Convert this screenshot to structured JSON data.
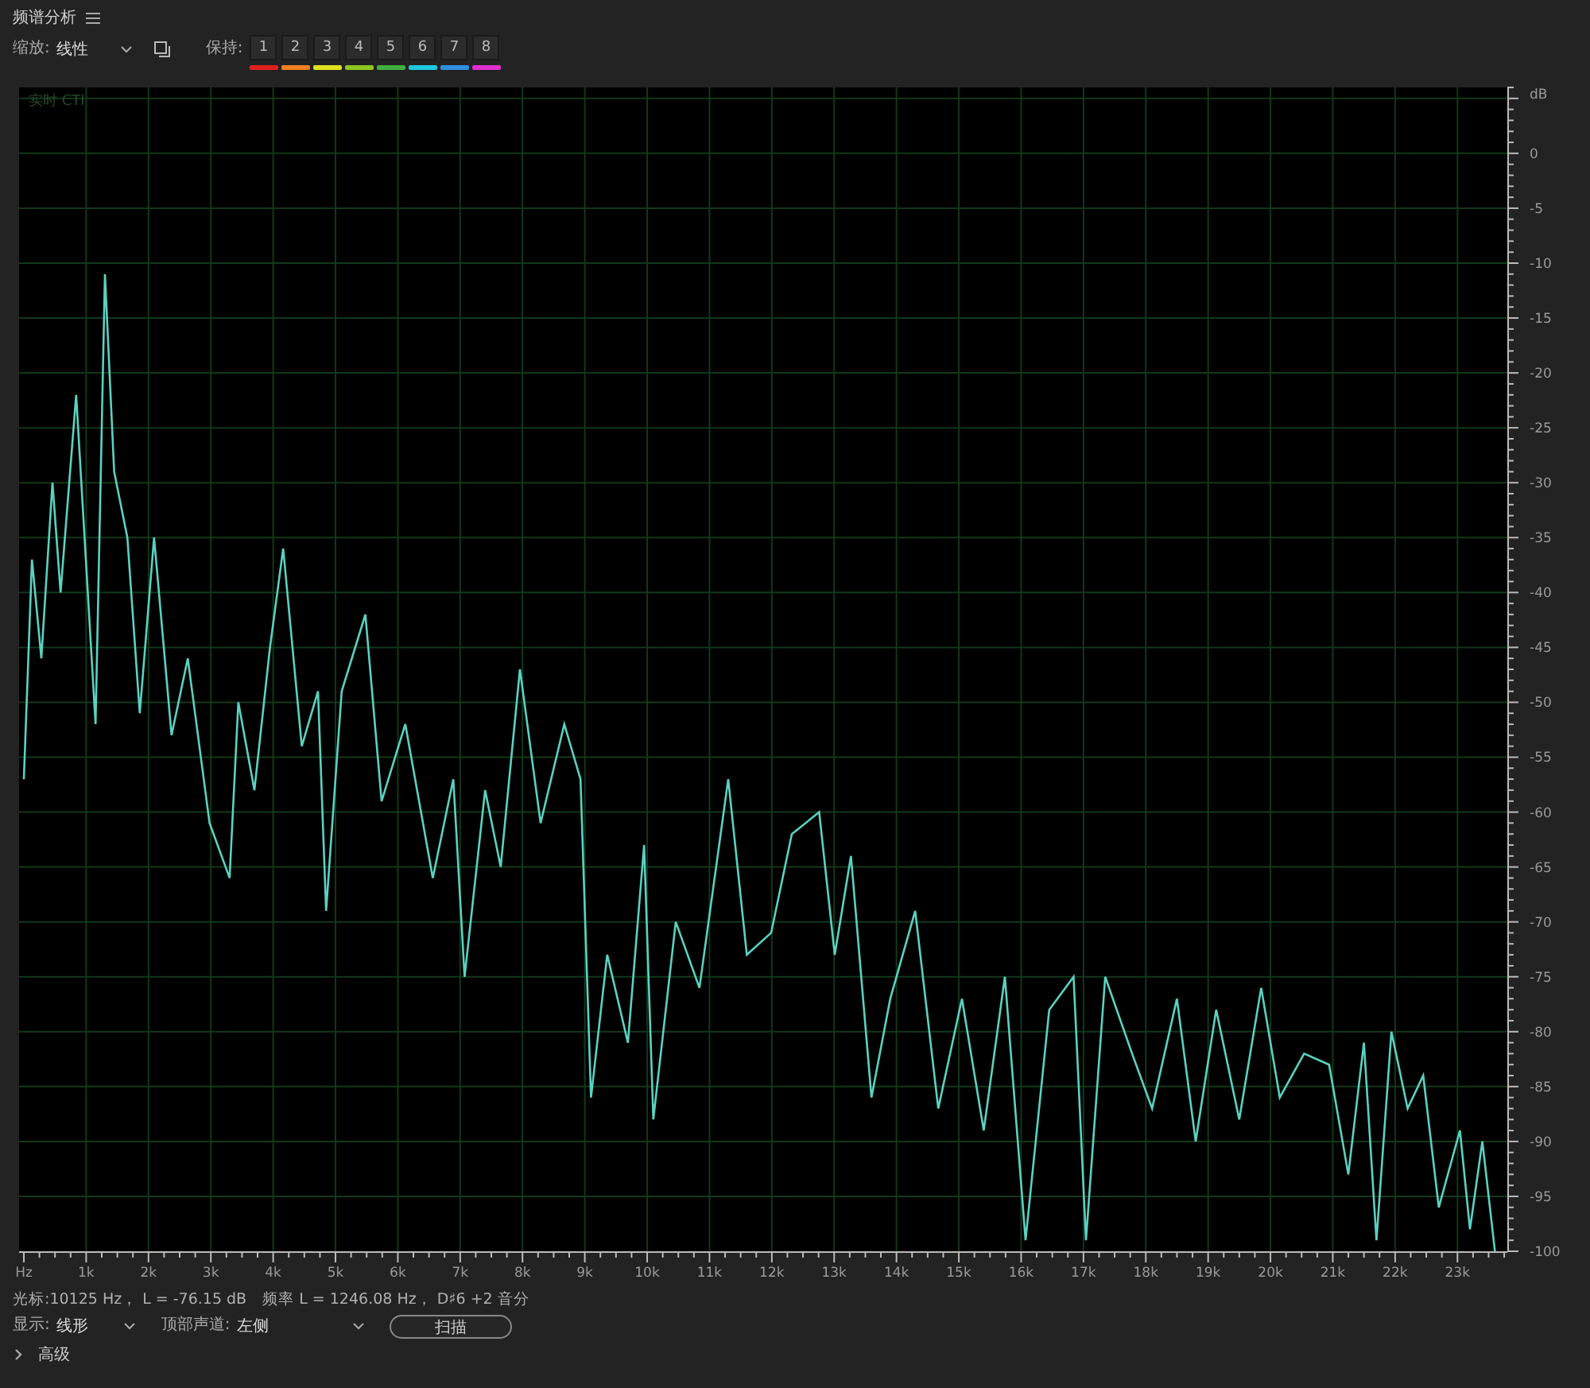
{
  "panel": {
    "title": "频谱分析"
  },
  "toolbar": {
    "zoom_label": "缩放:",
    "zoom_value": "线性",
    "hold_label": "保持:",
    "hold_slots": [
      {
        "label": "1",
        "color": "#e0201c"
      },
      {
        "label": "2",
        "color": "#f08020"
      },
      {
        "label": "3",
        "color": "#e0e020"
      },
      {
        "label": "4",
        "color": "#8cc820"
      },
      {
        "label": "5",
        "color": "#40b040"
      },
      {
        "label": "6",
        "color": "#20c8e0"
      },
      {
        "label": "7",
        "color": "#3090e0"
      },
      {
        "label": "8",
        "color": "#e030d0"
      }
    ]
  },
  "plot": {
    "overlay_label": "实时 CTI",
    "chart_data": {
      "type": "line",
      "grid": true,
      "ylabel": "dB",
      "xlim": [
        0,
        23.8
      ],
      "ylim": [
        -100,
        6
      ],
      "xticks": [
        {
          "value": 0,
          "label": "Hz"
        },
        {
          "value": 1,
          "label": "1k"
        },
        {
          "value": 2,
          "label": "2k"
        },
        {
          "value": 3,
          "label": "3k"
        },
        {
          "value": 4,
          "label": "4k"
        },
        {
          "value": 5,
          "label": "5k"
        },
        {
          "value": 6,
          "label": "6k"
        },
        {
          "value": 7,
          "label": "7k"
        },
        {
          "value": 8,
          "label": "8k"
        },
        {
          "value": 9,
          "label": "9k"
        },
        {
          "value": 10,
          "label": "10k"
        },
        {
          "value": 11,
          "label": "11k"
        },
        {
          "value": 12,
          "label": "12k"
        },
        {
          "value": 13,
          "label": "13k"
        },
        {
          "value": 14,
          "label": "14k"
        },
        {
          "value": 15,
          "label": "15k"
        },
        {
          "value": 16,
          "label": "16k"
        },
        {
          "value": 17,
          "label": "17k"
        },
        {
          "value": 18,
          "label": "18k"
        },
        {
          "value": 19,
          "label": "19k"
        },
        {
          "value": 20,
          "label": "20k"
        },
        {
          "value": 21,
          "label": "21k"
        },
        {
          "value": 22,
          "label": "22k"
        },
        {
          "value": 23,
          "label": "23k"
        }
      ],
      "yticks": [
        0,
        -5,
        -10,
        -15,
        -20,
        -25,
        -30,
        -35,
        -40,
        -45,
        -50,
        -55,
        -60,
        -65,
        -70,
        -75,
        -80,
        -85,
        -90,
        -95,
        -100
      ],
      "x": [
        0,
        0.13,
        0.28,
        0.46,
        0.59,
        0.84,
        1.15,
        1.3,
        1.45,
        1.66,
        1.86,
        2.09,
        2.37,
        2.63,
        2.98,
        3.3,
        3.44,
        3.7,
        3.95,
        4.16,
        4.46,
        4.72,
        4.85,
        5.1,
        5.48,
        5.74,
        6.12,
        6.56,
        6.89,
        7.07,
        7.4,
        7.65,
        7.96,
        8.29,
        8.67,
        8.93,
        9.1,
        9.36,
        9.69,
        9.95,
        10.1,
        10.46,
        10.84,
        11.3,
        11.6,
        11.99,
        12.32,
        12.76,
        13.01,
        13.27,
        13.6,
        13.9,
        14.3,
        14.67,
        15.05,
        15.4,
        15.74,
        16.07,
        16.45,
        16.84,
        17.04,
        17.35,
        17.78,
        18.1,
        18.5,
        18.8,
        19.13,
        19.5,
        19.85,
        20.15,
        20.54,
        20.94,
        21.25,
        21.5,
        21.7,
        21.94,
        22.2,
        22.45,
        22.7,
        23.04,
        23.2,
        23.4,
        23.6
      ],
      "series": [
        {
          "color": "#5ad2c0",
          "values": [
            -57,
            -37,
            -46,
            -30,
            -40,
            -22,
            -52,
            -11,
            -29,
            -35,
            -51,
            -35,
            -53,
            -46,
            -61,
            -66,
            -50,
            -58,
            -45,
            -36,
            -54,
            -49,
            -69,
            -49,
            -42,
            -59,
            -52,
            -66,
            -57,
            -75,
            -58,
            -65,
            -47,
            -61,
            -52,
            -57,
            -86,
            -73,
            -81,
            -63,
            -88,
            -70,
            -76,
            -57,
            -73,
            -71,
            -62,
            -60,
            -73,
            -64,
            -86,
            -77,
            -69,
            -87,
            -77,
            -89,
            -75,
            -99,
            -78,
            -75,
            -99,
            -75,
            -82,
            -87,
            -77,
            -90,
            -78,
            -88,
            -76,
            -86,
            -82,
            -83,
            -93,
            -81,
            -99,
            -80,
            -87,
            -84,
            -96,
            -89,
            -98,
            -90,
            -100
          ]
        }
      ]
    }
  },
  "status": {
    "cursor": "光标:10125 Hz， L = -76.15 dB",
    "frequency": "频率 L = 1246.08 Hz， D♯6 +2 音分"
  },
  "controls": {
    "display_label": "显示:",
    "display_value": "线形",
    "channel_label": "顶部声道:",
    "channel_value": "左侧",
    "scan_button": "扫描"
  },
  "advanced": {
    "label": "高级",
    "expanded": false
  }
}
